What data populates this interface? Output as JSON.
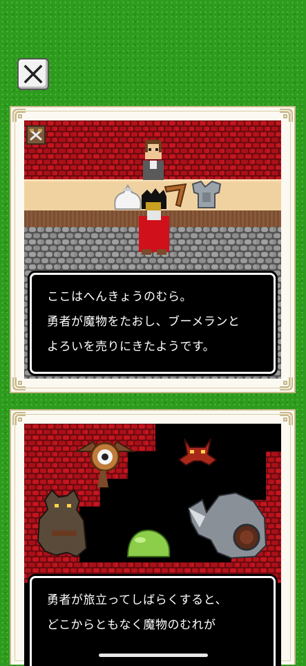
{
  "close_button": {
    "icon": "close-x-icon"
  },
  "story_panels": [
    {
      "scene": "village-shop",
      "lines": [
        "ここはへんきょうのむら。",
        "勇者が魔物をたおし、ブーメランと",
        "よろいを売りにきたようです。"
      ]
    },
    {
      "scene": "monster-lair",
      "lines": [
        "勇者が旅立ってしばらくすると、",
        "どこからともなく魔物のむれが"
      ]
    }
  ],
  "colors": {
    "grass": "#2e9a1e",
    "wall_red": "#b3121a",
    "counter": "#f0d2a0",
    "floor_stone": "#8a8a8a",
    "hero_cape": "#d0101a",
    "slime": "#8ccd4a"
  }
}
